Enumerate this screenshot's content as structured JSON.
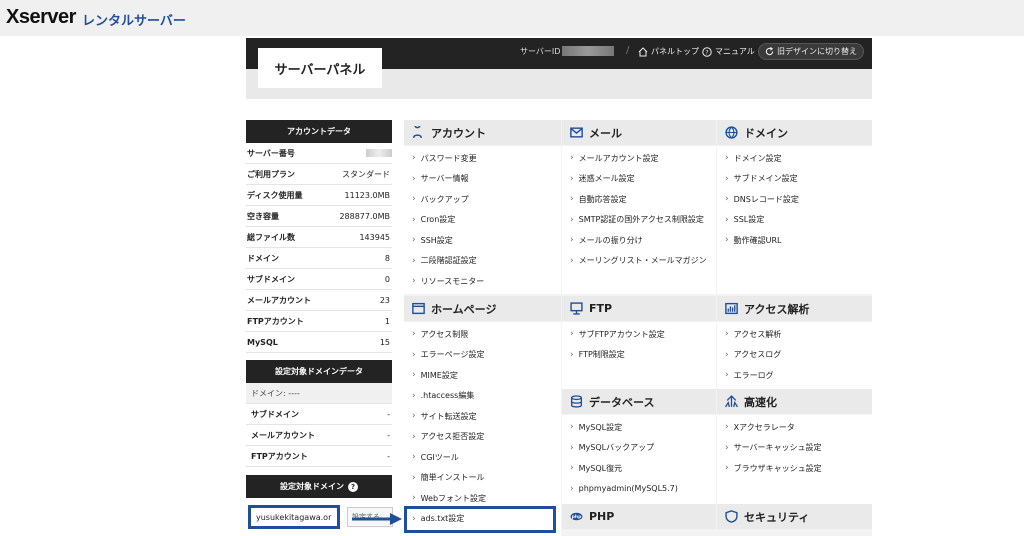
{
  "brand": {
    "name": "Xserver",
    "sub": "レンタルサーバー"
  },
  "header": {
    "title": "サーバーパネル",
    "server_id_label": "サーバーID",
    "panel_top": "パネルトップ",
    "manual": "マニュアル",
    "switch_design": "旧デザインに切り替え"
  },
  "account": {
    "title": "アカウントデータ",
    "rows": [
      {
        "k": "サーバー番号",
        "v": ""
      },
      {
        "k": "ご利用プラン",
        "v": "スタンダード"
      },
      {
        "k": "ディスク使用量",
        "v": "11123.0MB"
      },
      {
        "k": "空き容量",
        "v": "288877.0MB"
      },
      {
        "k": "総ファイル数",
        "v": "143945"
      },
      {
        "k": "ドメイン",
        "v": "8"
      },
      {
        "k": "サブドメイン",
        "v": "0"
      },
      {
        "k": "メールアカウント",
        "v": "23"
      },
      {
        "k": "FTPアカウント",
        "v": "1"
      },
      {
        "k": "MySQL",
        "v": "15"
      }
    ]
  },
  "domain_data": {
    "title": "設定対象ドメインデータ",
    "rows": [
      {
        "k": "ドメイン: ----",
        "v": ""
      },
      {
        "k": "サブドメイン",
        "v": "-"
      },
      {
        "k": "メールアカウント",
        "v": "-"
      },
      {
        "k": "FTPアカウント",
        "v": "-"
      }
    ]
  },
  "target_domain": {
    "title": "設定対象ドメイン",
    "value": "yusukekitagawa.or",
    "set_button": "設定する"
  },
  "sections": {
    "account": {
      "title": "アカウント",
      "items": [
        "パスワード変更",
        "サーバー情報",
        "バックアップ",
        "Cron設定",
        "SSH設定",
        "二段階認証設定",
        "リソースモニター"
      ]
    },
    "mail": {
      "title": "メール",
      "items": [
        "メールアカウント設定",
        "迷惑メール設定",
        "自動応答設定",
        "SMTP認証の国外アクセス制限設定",
        "メールの振り分け",
        "メーリングリスト・メールマガジン"
      ]
    },
    "domain": {
      "title": "ドメイン",
      "items": [
        "ドメイン設定",
        "サブドメイン設定",
        "DNSレコード設定",
        "SSL設定",
        "動作確認URL"
      ]
    },
    "homepage": {
      "title": "ホームページ",
      "items": [
        "アクセス制限",
        "エラーページ設定",
        "MIME設定",
        ".htaccess編集",
        "サイト転送設定",
        "アクセス拒否設定",
        "CGIツール",
        "簡単インストール",
        "Webフォント設定",
        "ads.txt設定"
      ]
    },
    "ftp": {
      "title": "FTP",
      "items": [
        "サブFTPアカウント設定",
        "FTP制限設定"
      ]
    },
    "analytics": {
      "title": "アクセス解析",
      "items": [
        "アクセス解析",
        "アクセスログ",
        "エラーログ"
      ]
    },
    "database": {
      "title": "データベース",
      "items": [
        "MySQL設定",
        "MySQLバックアップ",
        "MySQL復元",
        "phpmyadmin(MySQL5.7)"
      ]
    },
    "speed": {
      "title": "高速化",
      "items": [
        "Xアクセラレータ",
        "サーバーキャッシュ設定",
        "ブラウザキャッシュ設定"
      ]
    },
    "php": {
      "title": "PHP",
      "items": []
    },
    "security": {
      "title": "セキュリティ",
      "items": []
    }
  },
  "colors": {
    "accent": "#1f4e9c",
    "header_bg": "#232323"
  }
}
